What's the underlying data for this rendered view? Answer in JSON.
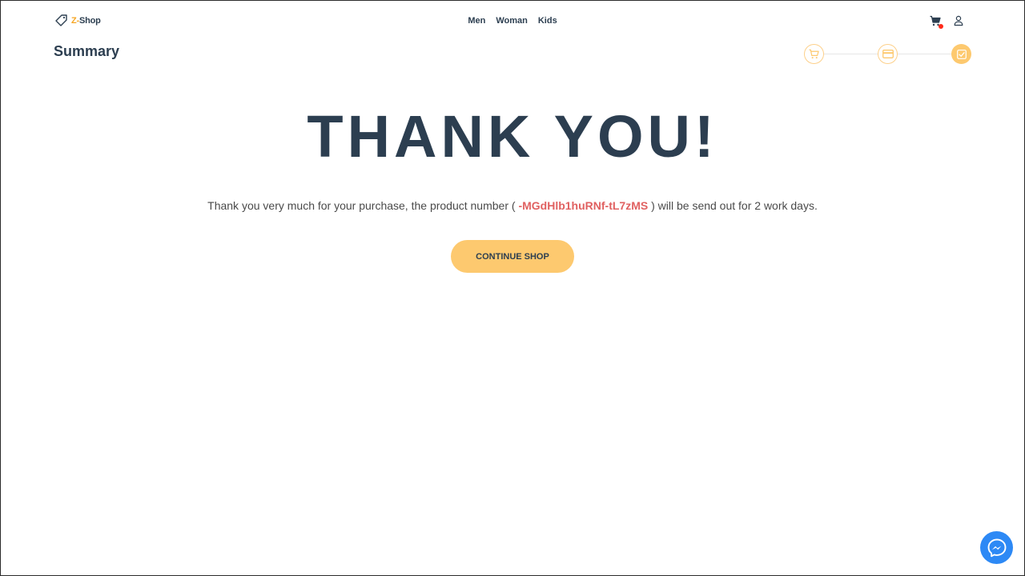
{
  "brand": {
    "prefix": "Z-",
    "name": "Shop"
  },
  "nav": {
    "items": [
      "Men",
      "Woman",
      "Kids"
    ]
  },
  "header": {
    "cart_badge_color": "#ff2a1a"
  },
  "page": {
    "title": "Summary"
  },
  "checkout_steps": [
    {
      "icon": "cart-icon",
      "state": "done"
    },
    {
      "icon": "credit-card-icon",
      "state": "done"
    },
    {
      "icon": "checkmark-icon",
      "state": "active"
    }
  ],
  "main": {
    "heading": "THANK YOU!",
    "message_before": "Thank you very much for your purchase, the product number ( ",
    "order_number": "-MGdHlb1huRNf-tL7zMS",
    "message_after": " ) will be send out for 2 work days.",
    "continue_label": "CONTINUE SHOP"
  },
  "colors": {
    "accent": "#fdc96f",
    "text_dark": "#2c3e50",
    "order_number": "#e06161",
    "messenger": "#2d89f5"
  },
  "chat": {
    "icon": "messenger-icon"
  }
}
